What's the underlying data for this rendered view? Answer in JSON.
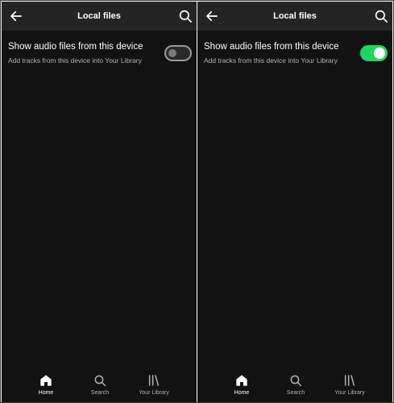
{
  "panels": [
    {
      "header": {
        "title": "Local files"
      },
      "setting": {
        "title": "Show audio files from this device",
        "subtitle": "Add tracks from this device into Your Library",
        "toggle_on": false
      },
      "nav": [
        {
          "label": "Home",
          "icon": "home-icon",
          "active": true
        },
        {
          "label": "Search",
          "icon": "search-icon",
          "active": false
        },
        {
          "label": "Your Library",
          "icon": "library-icon",
          "active": false
        }
      ]
    },
    {
      "header": {
        "title": "Local files"
      },
      "setting": {
        "title": "Show audio files from this device",
        "subtitle": "Add tracks from this device into Your Library",
        "toggle_on": true
      },
      "nav": [
        {
          "label": "Home",
          "icon": "home-icon",
          "active": true
        },
        {
          "label": "Search",
          "icon": "search-icon",
          "active": false
        },
        {
          "label": "Your Library",
          "icon": "library-icon",
          "active": false
        }
      ]
    }
  ],
  "colors": {
    "background": "#121212",
    "header": "#242424",
    "accent": "#1ed760",
    "text_primary": "#ffffff",
    "text_secondary": "#b3b3b3"
  }
}
